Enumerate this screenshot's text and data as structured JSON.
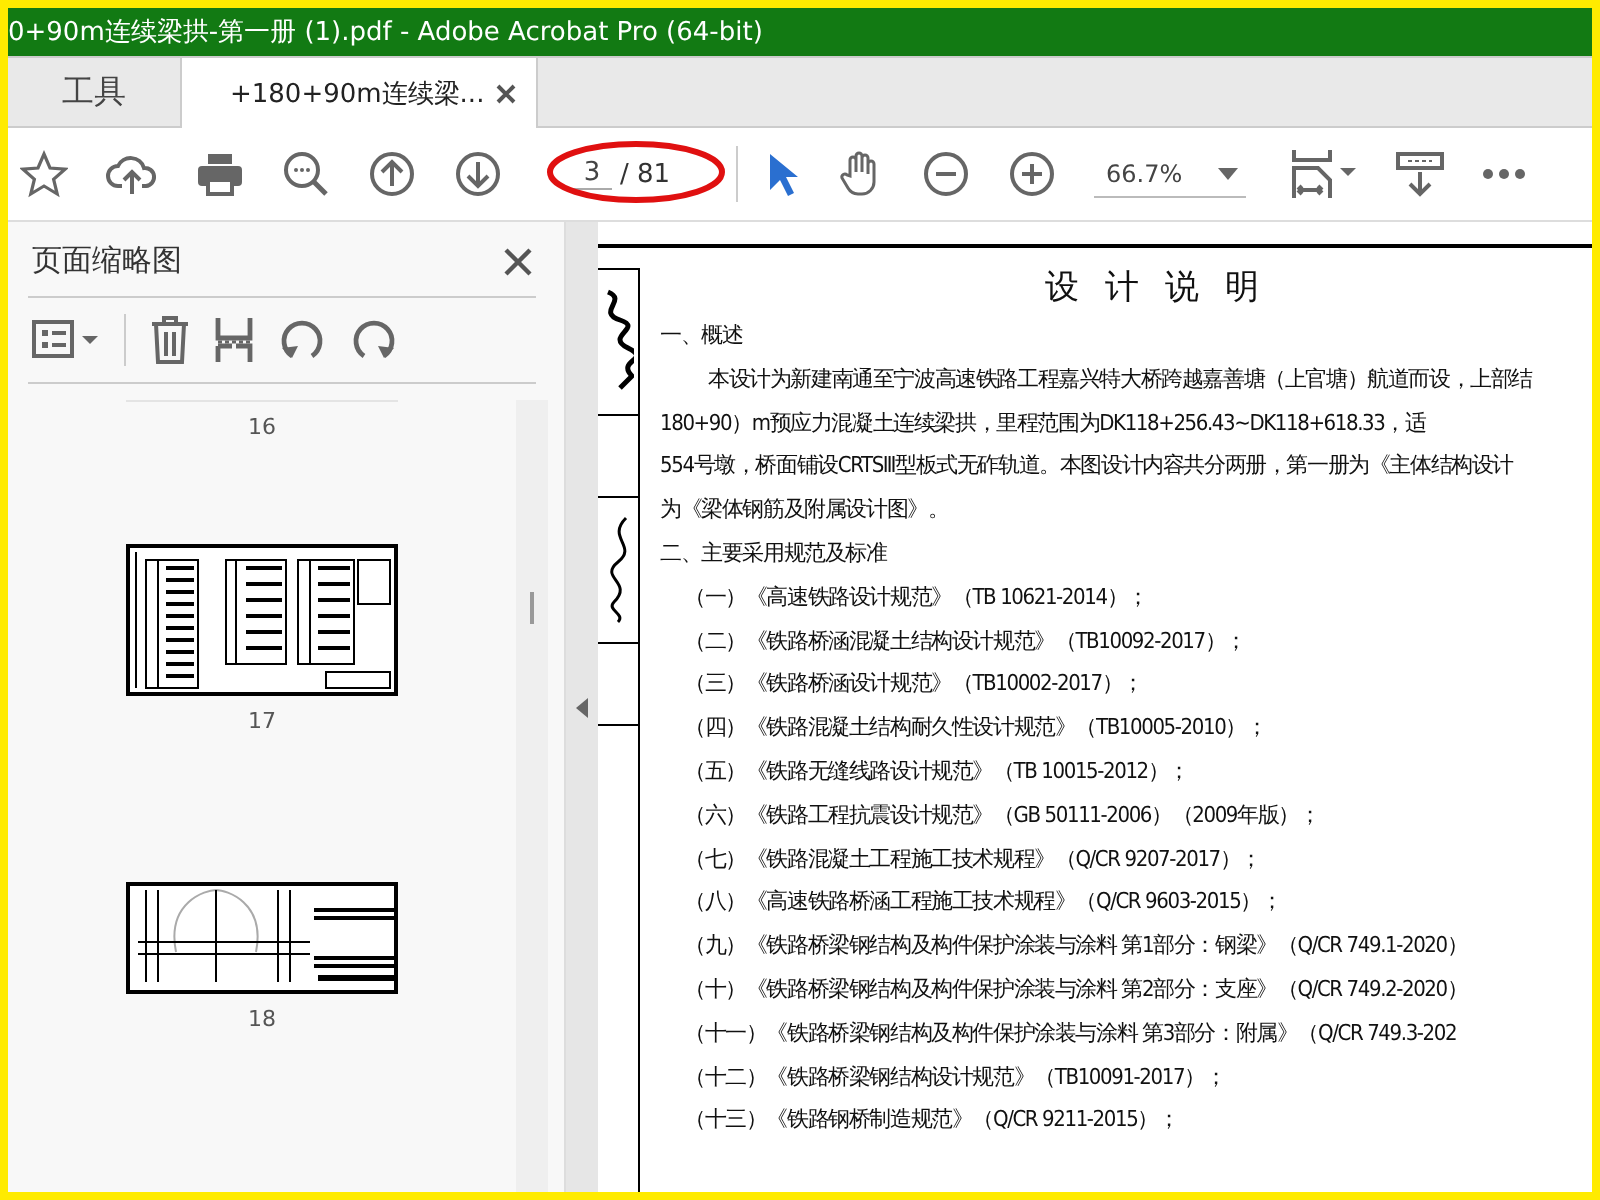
{
  "window": {
    "title": "0+90m连续梁拱-第一册 (1).pdf - Adobe Acrobat Pro (64-bit)"
  },
  "tabs": [
    {
      "label": "工具",
      "selected": false
    },
    {
      "label": "+180+90m连续梁...",
      "selected": true
    }
  ],
  "toolbar": {
    "page_current": "3",
    "page_total": "/ 81",
    "zoom": "66.7%"
  },
  "thumbnails_panel": {
    "title": "页面缩略图",
    "pages": [
      {
        "label": "16",
        "kind": "cut"
      },
      {
        "label": "17",
        "kind": "table"
      },
      {
        "label": "18",
        "kind": "drawing"
      }
    ]
  },
  "document": {
    "title": "设 计 说 明",
    "lines": [
      {
        "text": "一、概述",
        "kind": "heading"
      },
      {
        "text": "本设计为新建南通至宁波高速铁路工程嘉兴特大桥跨越嘉善塘（上官塘）航道而设，上部结",
        "kind": "para"
      },
      {
        "text": "180+90）m预应力混凝土连续梁拱，里程范围为DK118+256.43~DK118+618.33，适",
        "kind": "cont"
      },
      {
        "text": "554号墩，桥面铺设CRTSⅢ型板式无砟轨道。本图设计内容共分两册，第一册为《主体结构设计",
        "kind": "cont"
      },
      {
        "text": "为《梁体钢筋及附属设计图》。",
        "kind": "cont"
      },
      {
        "text": "二、主要采用规范及标准",
        "kind": "heading"
      },
      {
        "text": "（一）《高速铁路设计规范》（TB 10621-2014）；",
        "kind": "item"
      },
      {
        "text": "（二）《铁路桥涵混凝土结构设计规范》（TB10092-2017）；",
        "kind": "item"
      },
      {
        "text": "（三）《铁路桥涵设计规范》（TB10002-2017）；",
        "kind": "item"
      },
      {
        "text": "（四）《铁路混凝土结构耐久性设计规范》（TB10005-2010）；",
        "kind": "item"
      },
      {
        "text": "（五）《铁路无缝线路设计规范》（TB 10015-2012）；",
        "kind": "item"
      },
      {
        "text": "（六）《铁路工程抗震设计规范》（GB 50111-2006）（2009年版）；",
        "kind": "item"
      },
      {
        "text": "（七）《铁路混凝土工程施工技术规程》（Q/CR 9207-2017）；",
        "kind": "item"
      },
      {
        "text": "（八）《高速铁路桥涵工程施工技术规程》（Q/CR 9603-2015）；",
        "kind": "item"
      },
      {
        "text": "（九）《铁路桥梁钢结构及构件保护涂装与涂料 第1部分：钢梁》（Q/CR 749.1-2020）",
        "kind": "item"
      },
      {
        "text": "（十）《铁路桥梁钢结构及构件保护涂装与涂料 第2部分：支座》（Q/CR 749.2-2020）",
        "kind": "item"
      },
      {
        "text": "（十一）《铁路桥梁钢结构及构件保护涂装与涂料 第3部分：附属》（Q/CR 749.3-202",
        "kind": "item"
      },
      {
        "text": "（十二）《铁路桥梁钢结构设计规范》（TB10091-2017）；",
        "kind": "item"
      },
      {
        "text": "（十三）《铁路钢桥制造规范》（Q/CR 9211-2015）；",
        "kind": "item"
      }
    ]
  }
}
